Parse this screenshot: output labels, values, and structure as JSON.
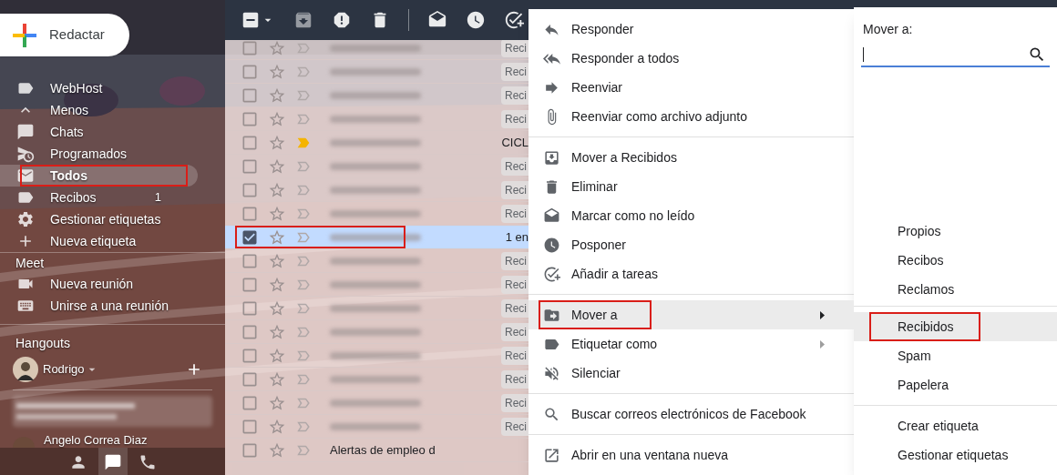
{
  "sidebar": {
    "compose": "Redactar",
    "labels": [
      {
        "label": "WebHost",
        "selected": false,
        "annotated": false
      },
      {
        "label": "Menos",
        "selected": false,
        "annotated": false
      },
      {
        "label": "Chats",
        "selected": false,
        "annotated": false
      },
      {
        "label": "Programados",
        "selected": false,
        "annotated": false
      },
      {
        "label": "Todos",
        "selected": true,
        "annotated": true
      },
      {
        "label": "Recibos",
        "selected": false,
        "annotated": false,
        "count": "1"
      },
      {
        "label": "Gestionar etiquetas",
        "selected": false,
        "annotated": false
      },
      {
        "label": "Nueva etiqueta",
        "selected": false,
        "annotated": false
      }
    ],
    "meet": {
      "title": "Meet",
      "items": [
        {
          "label": "Nueva reunión"
        },
        {
          "label": "Unirse a una reunión"
        }
      ]
    },
    "hangouts": {
      "title": "Hangouts",
      "user": "Rodrigo",
      "contacts": [
        {
          "name": "Angelo Correa Diaz"
        }
      ]
    }
  },
  "mail_list": {
    "select_all": {
      "indeterminate": true
    },
    "rows": [
      {
        "checked": false,
        "starred": false,
        "important": false,
        "selected": false,
        "annotated": false,
        "column_3": "Reci",
        "chip": true
      },
      {
        "checked": false,
        "starred": false,
        "important": false,
        "selected": false,
        "annotated": false,
        "column_3": "Reci",
        "chip": true
      },
      {
        "checked": false,
        "starred": false,
        "important": false,
        "selected": false,
        "annotated": false,
        "column_3": "Reci",
        "chip": true
      },
      {
        "checked": false,
        "starred": false,
        "important": false,
        "selected": false,
        "annotated": false,
        "column_3": "Reci",
        "chip": true
      },
      {
        "checked": false,
        "starred": false,
        "important": true,
        "selected": false,
        "annotated": false,
        "column_3": "CICL",
        "chip": false
      },
      {
        "checked": false,
        "starred": false,
        "important": false,
        "selected": false,
        "annotated": false,
        "column_3": "Reci",
        "chip": true
      },
      {
        "checked": false,
        "starred": false,
        "important": false,
        "selected": false,
        "annotated": false,
        "column_3": "Reci",
        "chip": true
      },
      {
        "checked": false,
        "starred": false,
        "important": false,
        "selected": false,
        "annotated": false,
        "column_3": "Reci",
        "chip": true
      },
      {
        "checked": true,
        "starred": false,
        "important": false,
        "selected": true,
        "annotated": true,
        "column_3": "1 en",
        "chip": false
      },
      {
        "checked": false,
        "starred": false,
        "important": false,
        "selected": false,
        "annotated": false,
        "column_3": "Reci",
        "chip": true
      },
      {
        "checked": false,
        "starred": false,
        "important": false,
        "selected": false,
        "annotated": false,
        "column_3": "Reci",
        "chip": true
      },
      {
        "checked": false,
        "starred": false,
        "important": false,
        "selected": false,
        "annotated": false,
        "column_3": "Reci",
        "chip": true
      },
      {
        "checked": false,
        "starred": false,
        "important": false,
        "selected": false,
        "annotated": false,
        "column_3": "Reci",
        "chip": true
      },
      {
        "checked": false,
        "starred": false,
        "important": false,
        "selected": false,
        "annotated": false,
        "column_3": "Reci",
        "chip": true
      },
      {
        "checked": false,
        "starred": false,
        "important": false,
        "selected": false,
        "annotated": false,
        "column_3": "Reci",
        "chip": true
      },
      {
        "checked": false,
        "starred": false,
        "important": false,
        "selected": false,
        "annotated": false,
        "column_3": "Reci",
        "chip": true
      },
      {
        "checked": false,
        "starred": false,
        "important": false,
        "selected": false,
        "annotated": false,
        "column_3": "Reci",
        "chip": true
      },
      {
        "checked": false,
        "starred": false,
        "important": false,
        "selected": false,
        "annotated": false,
        "sender": "Alertas de empleo d"
      }
    ]
  },
  "context_menu": {
    "groups": [
      [
        {
          "label": "Responder",
          "selected": false,
          "submenu": false,
          "annotated": false
        },
        {
          "label": "Responder a todos",
          "selected": false,
          "submenu": false,
          "annotated": false
        },
        {
          "label": "Reenviar",
          "selected": false,
          "submenu": false,
          "annotated": false
        },
        {
          "label": "Reenviar como archivo adjunto",
          "selected": false,
          "submenu": false,
          "annotated": false
        }
      ],
      [
        {
          "label": "Mover a Recibidos",
          "selected": false,
          "submenu": false,
          "annotated": false
        },
        {
          "label": "Eliminar",
          "selected": false,
          "submenu": false,
          "annotated": false
        },
        {
          "label": "Marcar como no leído",
          "selected": false,
          "submenu": false,
          "annotated": false
        },
        {
          "label": "Posponer",
          "selected": false,
          "submenu": false,
          "annotated": false
        },
        {
          "label": "Añadir a tareas",
          "selected": false,
          "submenu": false,
          "annotated": false
        }
      ],
      [
        {
          "label": "Mover a",
          "selected": true,
          "submenu": true,
          "annotated": true
        },
        {
          "label": "Etiquetar como",
          "selected": false,
          "submenu": true,
          "annotated": false
        },
        {
          "label": "Silenciar",
          "selected": false,
          "submenu": false,
          "annotated": false
        }
      ],
      [
        {
          "label": "Buscar correos electrónicos de Facebook",
          "selected": false,
          "submenu": false,
          "annotated": false
        }
      ],
      [
        {
          "label": "Abrir en una ventana nueva",
          "selected": false,
          "submenu": false,
          "annotated": false
        }
      ]
    ]
  },
  "move_menu": {
    "title": "Mover a:",
    "labels": [
      {
        "label": "Propios",
        "selected": false,
        "annotated": false
      },
      {
        "label": "Recibos",
        "selected": false,
        "annotated": false
      },
      {
        "label": "Reclamos",
        "selected": false,
        "annotated": false
      }
    ],
    "folders": [
      {
        "label": "Recibidos",
        "selected": true,
        "annotated": true
      },
      {
        "label": "Spam",
        "selected": false,
        "annotated": false
      },
      {
        "label": "Papelera",
        "selected": false,
        "annotated": false
      }
    ],
    "actions": [
      {
        "label": "Crear etiqueta"
      },
      {
        "label": "Gestionar etiquetas"
      }
    ]
  }
}
